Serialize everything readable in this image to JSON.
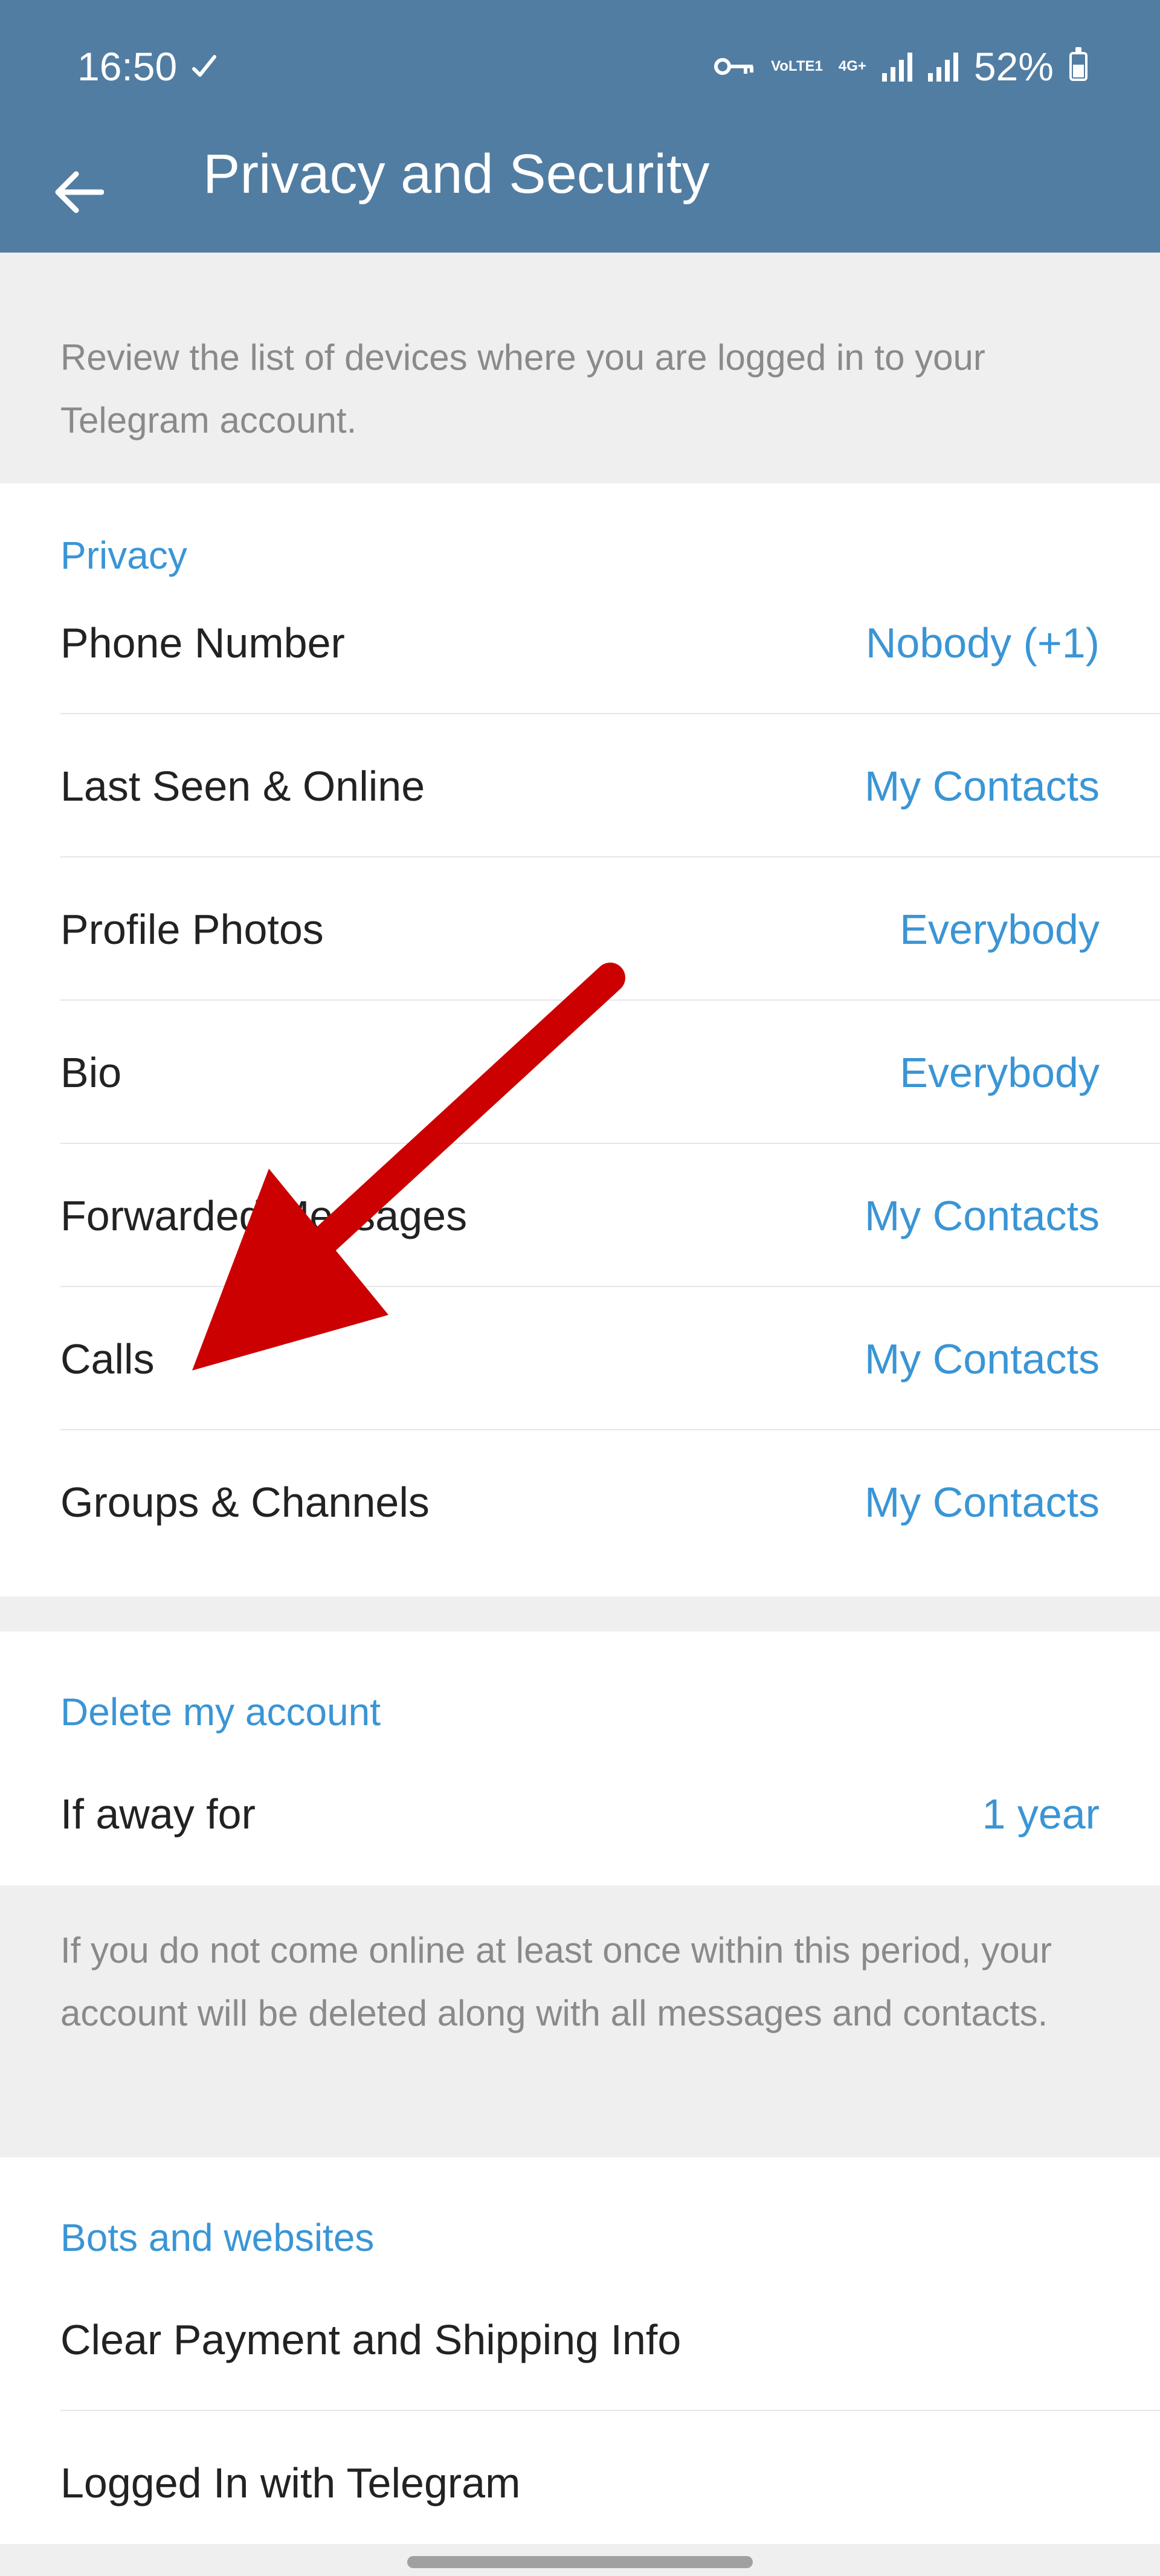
{
  "status_bar": {
    "time": "16:50",
    "battery": "52%",
    "battery_level": 0.52,
    "network_label_1": "VoLTE1",
    "network_label_2": "4G+"
  },
  "app_bar": {
    "title": "Privacy and Security"
  },
  "devices_hint": "Review the list of devices where you are logged in to your Telegram account.",
  "privacy": {
    "header": "Privacy",
    "items": [
      {
        "label": "Phone Number",
        "value": "Nobody (+1)"
      },
      {
        "label": "Last Seen & Online",
        "value": "My Contacts"
      },
      {
        "label": "Profile Photos",
        "value": "Everybody"
      },
      {
        "label": "Bio",
        "value": "Everybody"
      },
      {
        "label": "Forwarded Messages",
        "value": "My Contacts"
      },
      {
        "label": "Calls",
        "value": "My Contacts"
      },
      {
        "label": "Groups & Channels",
        "value": "My Contacts"
      }
    ]
  },
  "delete_account": {
    "header": "Delete my account",
    "label": "If away for",
    "value": "1 year",
    "hint": "If you do not come online at least once within this period, your account will be deleted along with all messages and contacts."
  },
  "bots": {
    "header": "Bots and websites",
    "items": [
      {
        "label": "Clear Payment and Shipping Info"
      },
      {
        "label": "Logged In with Telegram"
      }
    ]
  },
  "colors": {
    "header": "#517da2",
    "accent": "#3a95d5",
    "annotation_arrow": "#cc0000"
  },
  "icons": {
    "back": "arrow-left-icon",
    "time_mark": "check-icon",
    "vpn": "key-icon"
  }
}
